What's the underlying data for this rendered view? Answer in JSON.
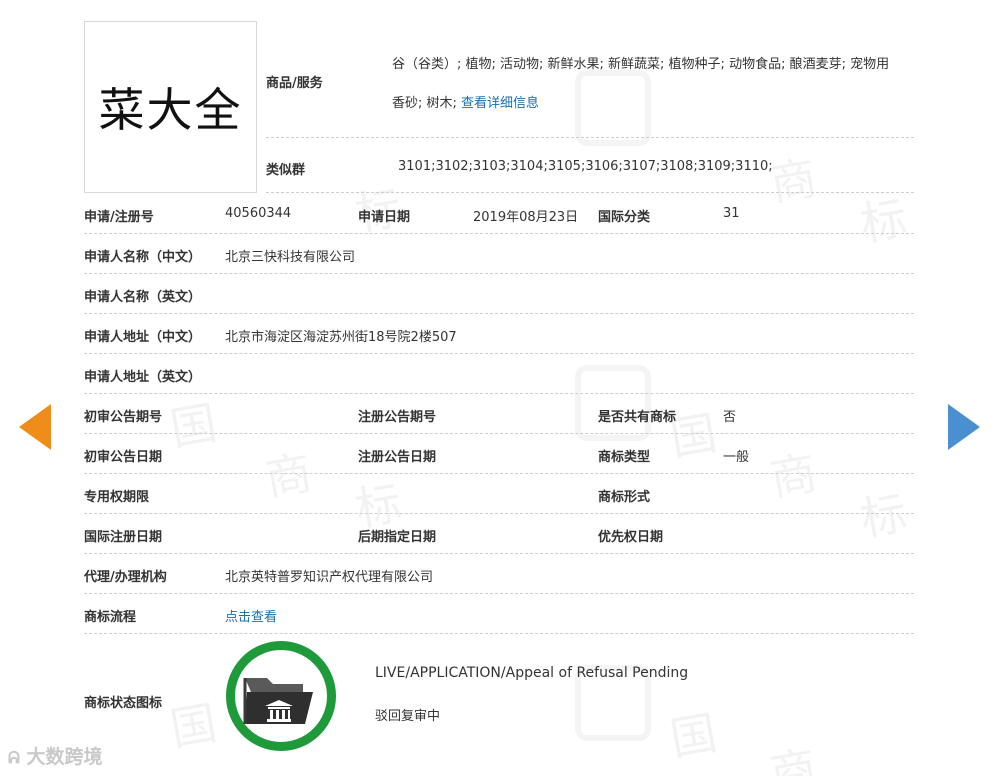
{
  "trademark": {
    "logo_text": "菜大全"
  },
  "goods": {
    "label": "商品/服务",
    "line1": "谷（谷类）; 植物; 活动物; 新鲜水果; 新鲜蔬菜; 植物种子; 动物食品; 酿酒麦芽; 宠物用",
    "line2": "香砂; 树木;",
    "detail_link": "查看详细信息"
  },
  "similar_groups": {
    "label": "类似群",
    "value": "3101;3102;3103;3104;3105;3106;3107;3108;3109;3110;"
  },
  "rows": {
    "reg_no": {
      "label": "申请/注册号",
      "value": "40560344"
    },
    "app_date": {
      "label": "申请日期",
      "value": "2019年08月23日"
    },
    "intl_class": {
      "label": "国际分类",
      "value": "31"
    },
    "applicant_cn": {
      "label": "申请人名称（中文）",
      "value": "北京三快科技有限公司"
    },
    "applicant_en": {
      "label": "申请人名称（英文）",
      "value": ""
    },
    "address_cn": {
      "label": "申请人地址（中文）",
      "value": "北京市海淀区海淀苏州街18号院2楼507"
    },
    "address_en": {
      "label": "申请人地址（英文）",
      "value": ""
    },
    "prelim_issue": {
      "label": "初审公告期号",
      "value": ""
    },
    "reg_issue": {
      "label": "注册公告期号",
      "value": ""
    },
    "shared": {
      "label": "是否共有商标",
      "value": "否"
    },
    "prelim_date": {
      "label": "初审公告日期",
      "value": ""
    },
    "reg_date": {
      "label": "注册公告日期",
      "value": ""
    },
    "tm_type": {
      "label": "商标类型",
      "value": "一般"
    },
    "exclusive_period": {
      "label": "专用权期限",
      "value": ""
    },
    "tm_form": {
      "label": "商标形式",
      "value": ""
    },
    "intl_reg_date": {
      "label": "国际注册日期",
      "value": ""
    },
    "later_designation": {
      "label": "后期指定日期",
      "value": ""
    },
    "priority_date": {
      "label": "优先权日期",
      "value": ""
    },
    "agent": {
      "label": "代理/办理机构",
      "value": "北京英特普罗知识产权代理有限公司"
    },
    "process": {
      "label": "商标流程",
      "link": "点击查看"
    }
  },
  "status": {
    "label": "商标状态图标",
    "en": "LIVE/APPLICATION/Appeal of Refusal Pending",
    "cn": "驳回复审中",
    "ring_color": "#1f9a3a",
    "icon": "folder-court-icon"
  },
  "nav": {
    "prev_icon": "arrow-left-icon",
    "next_icon": "arrow-right-icon",
    "prev_color": "#f08c1a",
    "next_color": "#4a8fd0"
  },
  "footer": {
    "brand": "大数跨境"
  }
}
